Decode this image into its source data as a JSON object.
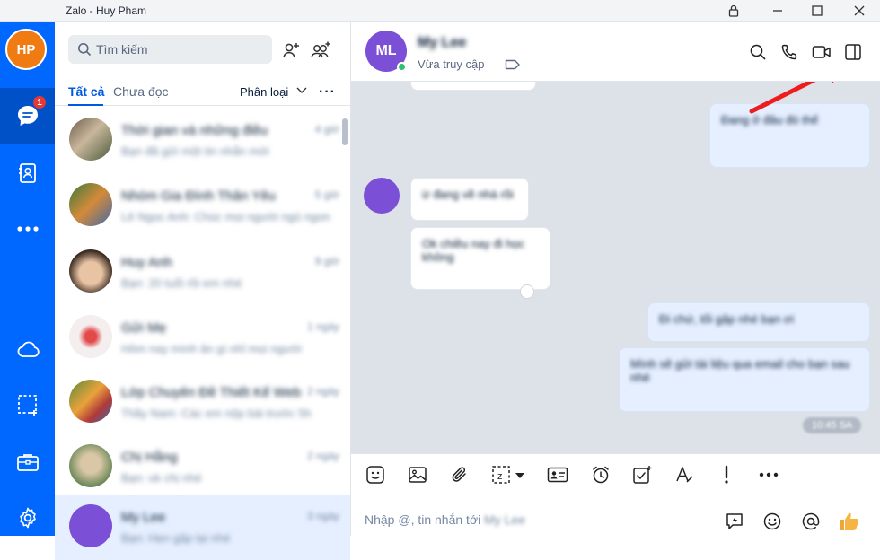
{
  "window": {
    "title": "Zalo - Huy Pham"
  },
  "nav": {
    "avatar_initials": "HP",
    "unread_badge": "1",
    "accent_color": "#0068ff"
  },
  "list": {
    "search_placeholder": "Tìm kiếm",
    "tabs": [
      "Tất cả",
      "Chưa đọc"
    ],
    "filter_label": "Phân loại",
    "conversations": [
      {
        "name": "Thời gian và những điều",
        "preview": "Bạn đã gửi một tin nhắn mới",
        "time": "4 giờ"
      },
      {
        "name": "Nhóm Gia Đình Thân Yêu",
        "preview": "Lê Ngọc Anh: Chúc mọi người ngủ ngon",
        "time": "5 giờ"
      },
      {
        "name": "Huy Anh",
        "preview": "Bạn: 20 tuổi rồi em nhé",
        "time": "9 giờ"
      },
      {
        "name": "Gửi Mẹ",
        "preview": "Hôm nay mình ăn gì nhỉ mọi người",
        "time": "1 ngày"
      },
      {
        "name": "Lớp Chuyên Đề Thiết Kế Web",
        "preview": "Thầy Nam: Các em nộp bài trước 5h",
        "time": "2 ngày"
      },
      {
        "name": "Chị Hằng",
        "preview": "Bạn: ok chị nhé",
        "time": "2 ngày"
      },
      {
        "name": "My Lee",
        "preview": "Bạn: Hẹn gặp lại nhé",
        "time": "3 ngày"
      }
    ]
  },
  "chat": {
    "avatar_initials": "ML",
    "name": "My Lee",
    "status": "Vừa truy cập",
    "messages": [
      {
        "from": "me",
        "text": "Đang ở đâu đó thế"
      },
      {
        "from": "them",
        "text": "ừ đang về nhà rồi"
      },
      {
        "from": "them",
        "text": "Ok chiều nay đi học không"
      },
      {
        "from": "me",
        "text": "Đi chứ, tối gặp nhé bạn ơi"
      },
      {
        "from": "me",
        "text": "Mình sẽ gửi tài liệu qua email cho bạn sau nhé"
      }
    ],
    "timestamp": "10:45 SA"
  },
  "composer": {
    "placeholder_prefix": "Nhập @, tin nhắn tới",
    "placeholder_name": "My Lee"
  }
}
